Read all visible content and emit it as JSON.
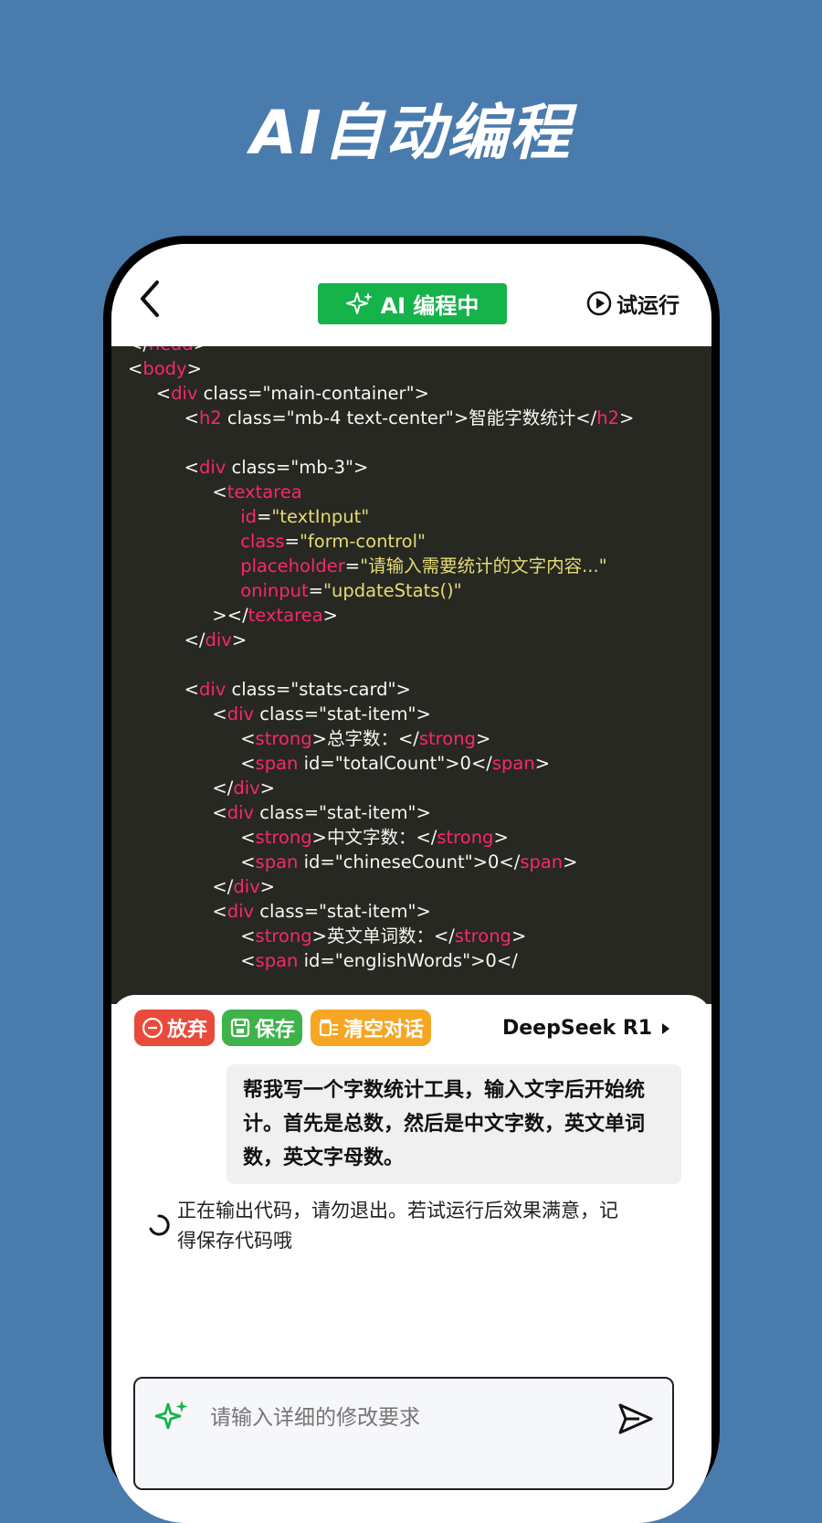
{
  "hero": {
    "title": "AI自动编程"
  },
  "topbar": {
    "status_label": "AI 编程中",
    "run_label": "试运行"
  },
  "code_lines": [
    "</head>",
    "<body>",
    "<div class=\"main-container\">",
    "<h2 class=\"mb-4 text-center\">智能字数统计</h2>",
    "<div class=\"mb-3\">",
    "<textarea",
    "id=\"textInput\"",
    "class=\"form-control\"",
    "placeholder=\"请输入需要统计的文字内容...\"",
    "oninput=\"updateStats()\"",
    "></textarea>",
    "</div>",
    "<div class=\"stats-card\">",
    "<div class=\"stat-item\">",
    "<strong>总字数：</strong>",
    "<span id=\"totalCount\">0</span>",
    "</div>",
    "<div class=\"stat-item\">",
    "<strong>中文字数：</strong>",
    "<span id=\"chineseCount\">0</span>",
    "</div>",
    "<div class=\"stat-item\">",
    "<strong>英文单词数：</strong>",
    "<span id=\"englishWords\">0</"
  ],
  "actions": {
    "discard": "放弃",
    "save": "保存",
    "clear": "清空对话"
  },
  "model": {
    "name": "DeepSeek R1"
  },
  "chat": {
    "user_message": "帮我写一个字数统计工具，输入文字后开始统计。首先是总数，然后是中文字数，英文单词数，英文字母数。",
    "ai_status": "正在输出代码，请勿退出。若试运行后效果满意，记得保存代码哦"
  },
  "input": {
    "placeholder": "请输入详细的修改要求"
  },
  "colors": {
    "background": "#4a7bad",
    "status_green": "#16b34a",
    "discard_red": "#e84b3c",
    "save_green": "#3eb34a",
    "clear_orange": "#f5a623",
    "code_bg": "#272822"
  }
}
